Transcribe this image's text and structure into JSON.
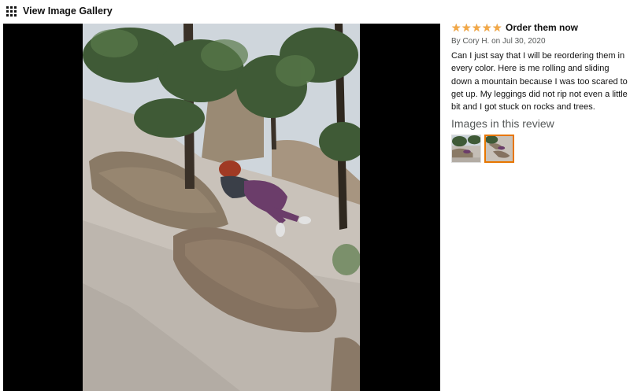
{
  "header": {
    "gallery_icon": "grid-icon",
    "gallery_label": "View Image Gallery"
  },
  "viewer": {
    "image_description_icon": "review-photo"
  },
  "review": {
    "rating": 5,
    "rating_max": 5,
    "star_color": "#f3a847",
    "title": "Order them now",
    "byline": "By Cory H. on Jul 30, 2020",
    "body": "Can I just say that I will be reordering them in every color. Here is me rolling and sliding down a mountain because I was too scared to get up. My leggings did not rip not even a little bit and I got stuck on rocks and trees.",
    "images_heading": "Images in this review",
    "thumbnails": [
      {
        "selected": false
      },
      {
        "selected": true
      }
    ],
    "selected_border_color": "#e77600"
  }
}
